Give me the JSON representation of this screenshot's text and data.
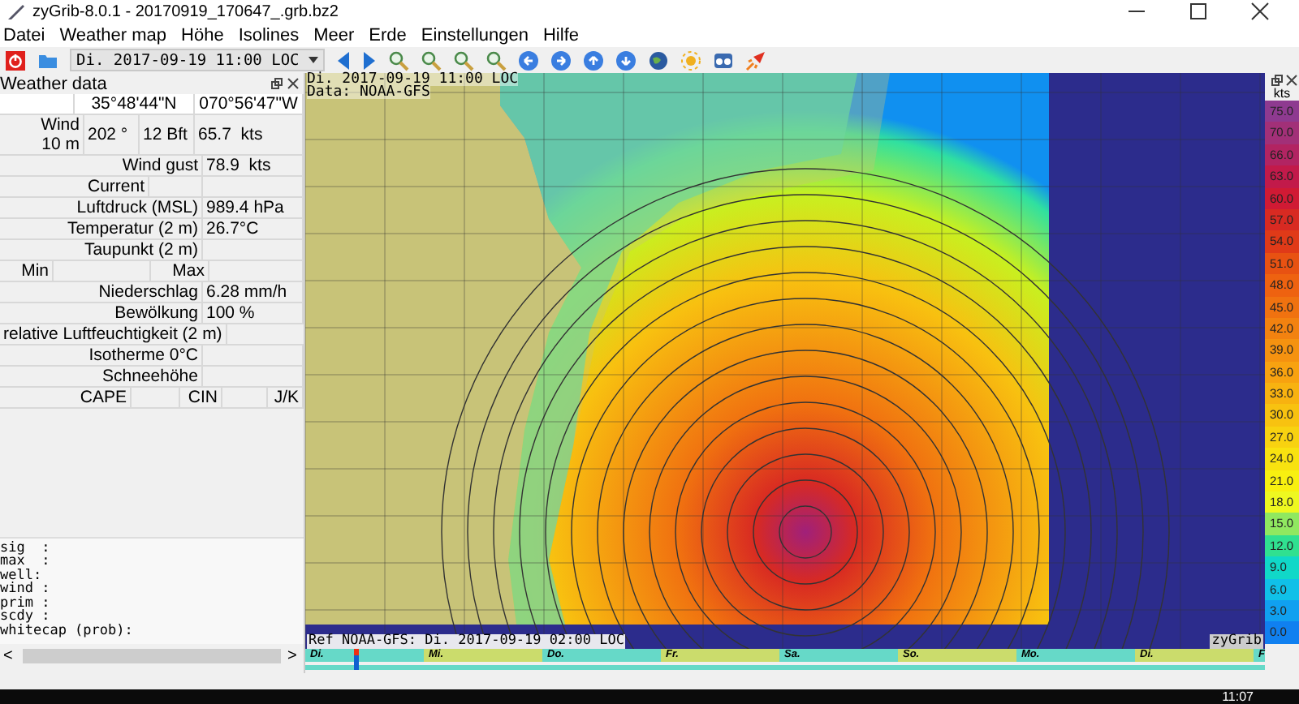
{
  "window": {
    "title": "zyGrib-8.0.1 - 20170919_170647_.grb.bz2"
  },
  "menu": [
    "Datei",
    "Weather map",
    "Höhe",
    "Isolines",
    "Meer",
    "Erde",
    "Einstellungen",
    "Hilfe"
  ],
  "toolbar": {
    "date": "Di. 2017-09-19 11:00 LOC"
  },
  "weather_panel": {
    "title": "Weather data",
    "rows": [
      {
        "kind": "coords",
        "cells": [
          "",
          "35°48'44\"N",
          "070°56'47\"W"
        ]
      },
      {
        "kind": "wind",
        "cells": [
          "Wind\n10 m",
          "202 °",
          "12 Bft",
          "65.7  kts"
        ]
      },
      {
        "kind": "pair",
        "cells": [
          "Wind gust",
          "78.9  kts"
        ]
      },
      {
        "kind": "current",
        "cells": [
          "Current",
          "",
          ""
        ]
      },
      {
        "kind": "pair",
        "cells": [
          "Luftdruck (MSL)",
          "989.4 hPa"
        ]
      },
      {
        "kind": "pair",
        "cells": [
          "Temperatur (2 m)",
          "26.7°C"
        ]
      },
      {
        "kind": "pair",
        "cells": [
          "Taupunkt (2 m)",
          ""
        ]
      },
      {
        "kind": "minmax",
        "cells": [
          "Min",
          "",
          "Max",
          ""
        ]
      },
      {
        "kind": "pair",
        "cells": [
          "Niederschlag",
          "6.28 mm/h"
        ]
      },
      {
        "kind": "pair",
        "cells": [
          "Bewölkung",
          "100 %"
        ]
      },
      {
        "kind": "pair",
        "cells": [
          "relative Luftfeuchtigkeit (2 m)",
          ""
        ]
      },
      {
        "kind": "pair",
        "cells": [
          "Isotherme 0°C",
          ""
        ]
      },
      {
        "kind": "pair",
        "cells": [
          "Schneehöhe",
          ""
        ]
      },
      {
        "kind": "capecin",
        "cells": [
          "CAPE",
          "",
          "CIN",
          "",
          "J/K"
        ]
      }
    ],
    "wave_lines": [
      "sig  :",
      "max  :",
      "well:",
      "wind :",
      "prim :",
      "scdy :",
      "whitecap (prob):"
    ],
    "scroll_left": "<",
    "scroll_right": ">"
  },
  "map": {
    "header": [
      "Di. 2017-09-19 11:00 LOC",
      "Data: NOAA-GFS"
    ],
    "footer": "Ref NOAA-GFS: Di. 2017-09-19 02:00 LOC",
    "credit": "zyGrib"
  },
  "timeline": {
    "level": 0.05,
    "days": [
      {
        "label": "Di.",
        "color": "#66d9c8"
      },
      {
        "label": "Mi.",
        "color": "#cbdc6c"
      },
      {
        "label": "Do.",
        "color": "#66d9c8"
      },
      {
        "label": "Fr.",
        "color": "#cbdc6c"
      },
      {
        "label": "Sa.",
        "color": "#66d9c8"
      },
      {
        "label": "So.",
        "color": "#cbdc6c"
      },
      {
        "label": "Mo.",
        "color": "#66d9c8"
      },
      {
        "label": "Di.",
        "color": "#cbdc6c"
      },
      {
        "label": "F",
        "color": "#66d9c8"
      }
    ]
  },
  "legend": {
    "unit": "kts",
    "steps": [
      {
        "label": "75.0",
        "color": "#8e3a90"
      },
      {
        "label": "70.0",
        "color": "#a23078"
      },
      {
        "label": "66.0",
        "color": "#b22462"
      },
      {
        "label": "63.0",
        "color": "#c21a4a"
      },
      {
        "label": "60.0",
        "color": "#d01a34"
      },
      {
        "label": "57.0",
        "color": "#d82a22"
      },
      {
        "label": "54.0",
        "color": "#e03a18"
      },
      {
        "label": "51.0",
        "color": "#e85212"
      },
      {
        "label": "48.0",
        "color": "#ee6210"
      },
      {
        "label": "45.0",
        "color": "#f07210"
      },
      {
        "label": "42.0",
        "color": "#f28210"
      },
      {
        "label": "39.0",
        "color": "#f59210"
      },
      {
        "label": "36.0",
        "color": "#f8a210"
      },
      {
        "label": "33.0",
        "color": "#f8b210"
      },
      {
        "label": "30.0",
        "color": "#f8c210"
      },
      {
        "label": "27.0",
        "color": "#f8d210"
      },
      {
        "label": "24.0",
        "color": "#f8e210"
      },
      {
        "label": "21.0",
        "color": "#f8f010"
      },
      {
        "label": "18.0",
        "color": "#eef820"
      },
      {
        "label": "15.0",
        "color": "#90e860"
      },
      {
        "label": "12.0",
        "color": "#30e090"
      },
      {
        "label": "9.0",
        "color": "#10d8c8"
      },
      {
        "label": "6.0",
        "color": "#10c0e8"
      },
      {
        "label": "3.0",
        "color": "#10a0f0"
      },
      {
        "label": "0.0",
        "color": "#1080f0"
      }
    ]
  },
  "taskbar": {
    "clock": "11:07"
  }
}
